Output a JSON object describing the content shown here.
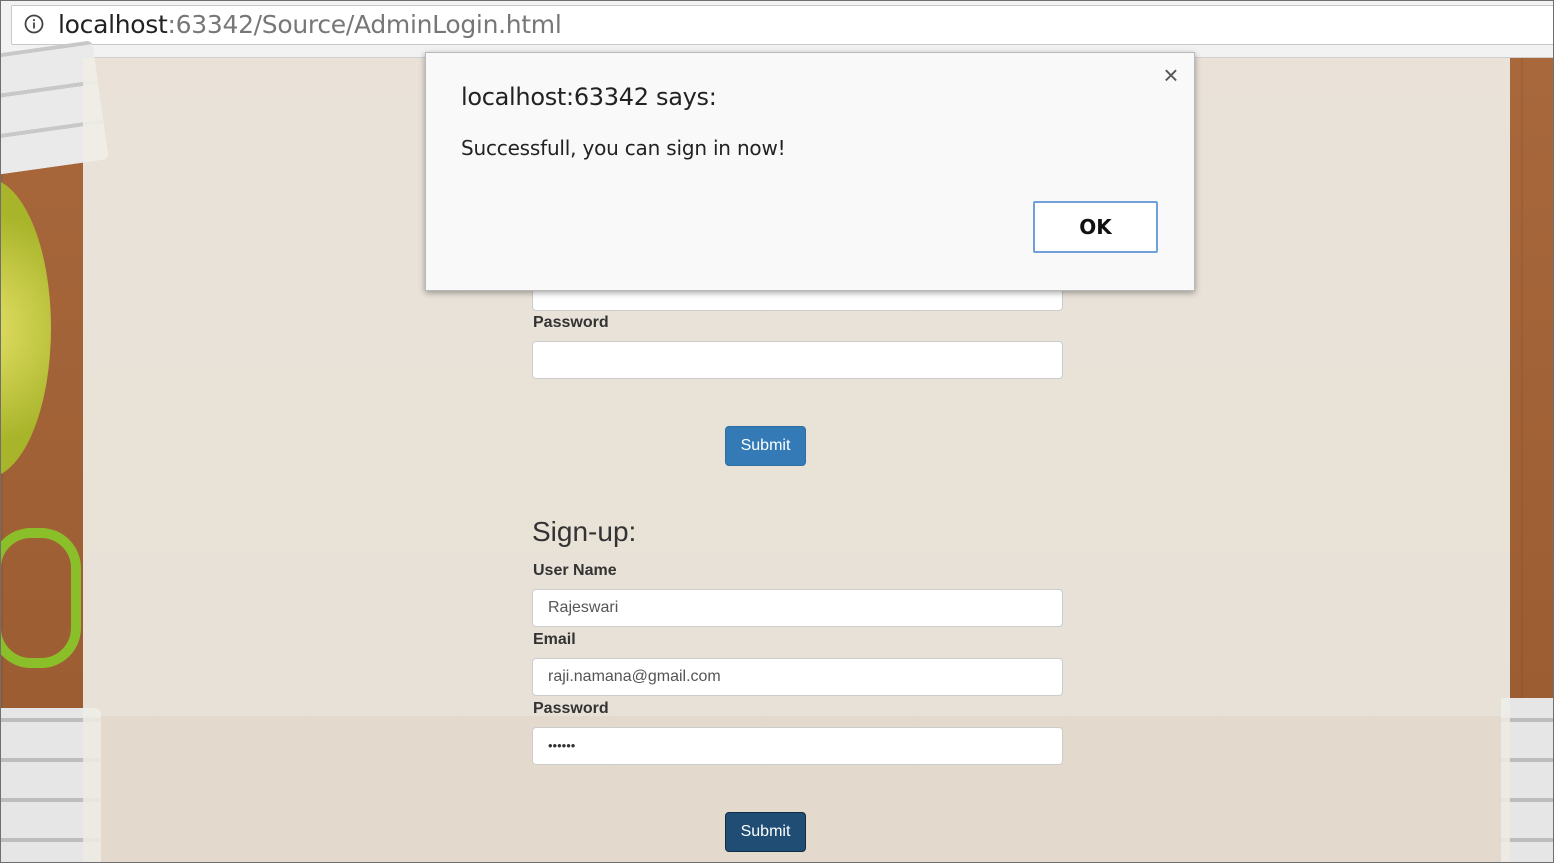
{
  "browser": {
    "url_host": "localhost",
    "url_path": ":63342/Source/AdminLogin.html"
  },
  "login": {
    "password_label": "Password",
    "password_value": "",
    "submit_label": "Submit"
  },
  "signup": {
    "title": "Sign-up:",
    "username_label": "User Name",
    "username_value": "Rajeswari",
    "email_label": "Email",
    "email_value": "raji.namana@gmail.com",
    "password_label": "Password",
    "password_value": "••••••",
    "submit_label": "Submit"
  },
  "dialog": {
    "title": "localhost:63342 says:",
    "message": "Successfull, you can sign in now!",
    "ok_label": "OK",
    "close_glyph": "×"
  },
  "colors": {
    "primary_button": "#337ab7",
    "active_button": "#204d74",
    "dialog_ok_border": "#6fa1d8"
  }
}
